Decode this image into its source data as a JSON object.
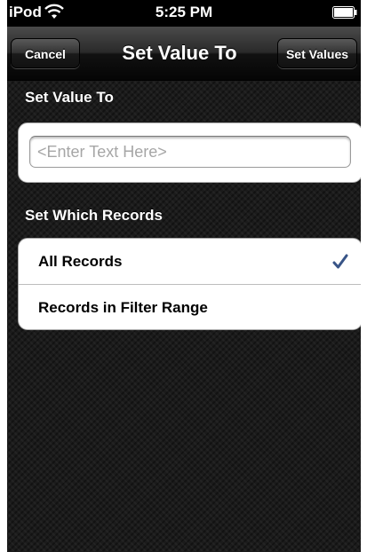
{
  "status_bar": {
    "carrier": "iPod",
    "time": "5:25 PM",
    "icons": [
      "wifi-icon",
      "battery-icon"
    ]
  },
  "nav": {
    "title": "Set Value To",
    "left_button": "Cancel",
    "right_button": "Set Values"
  },
  "value_section": {
    "header": "Set Value To",
    "field_value": "",
    "field_placeholder": "<Enter Text Here>"
  },
  "records_section": {
    "header": "Set Which Records",
    "options": [
      {
        "label": "All Records",
        "selected": true
      },
      {
        "label": "Records in Filter Range",
        "selected": false
      }
    ]
  },
  "colors": {
    "checkmark": "#385487",
    "background": "#1b1b1b",
    "cell_background": "#ffffff"
  }
}
